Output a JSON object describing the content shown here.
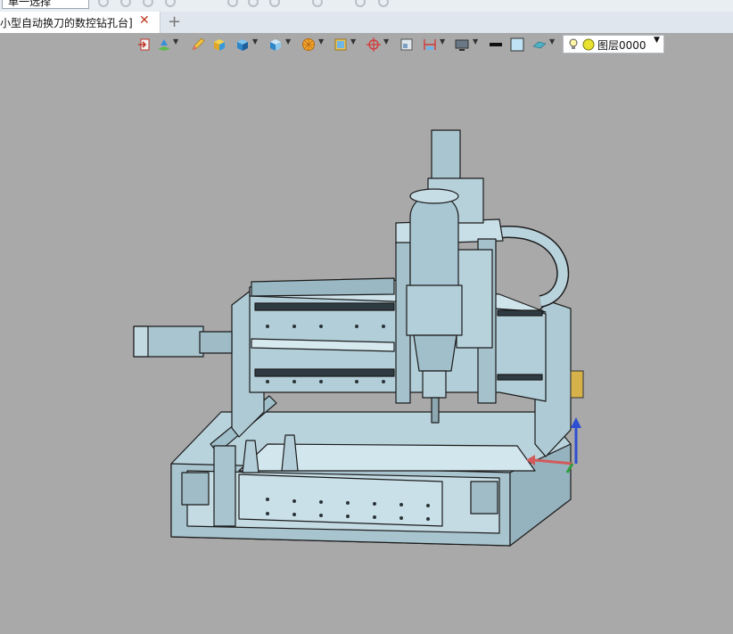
{
  "top": {
    "selection_filter": "单一选择"
  },
  "tab": {
    "title": "小型自动换刀的数控钻孔台]",
    "close_glyph": "✕",
    "add_glyph": "+"
  },
  "toolbar": {
    "layer_value": "图层0000",
    "layer_arrow": "▼"
  },
  "colors": {
    "viewport_bg": "#a9a9a9",
    "model_fill": "#b9d3dd",
    "model_edge": "#1b1b1b",
    "axis_x": "#d25a5a",
    "axis_y": "#2f9e3a",
    "axis_z": "#2e4fd1"
  }
}
